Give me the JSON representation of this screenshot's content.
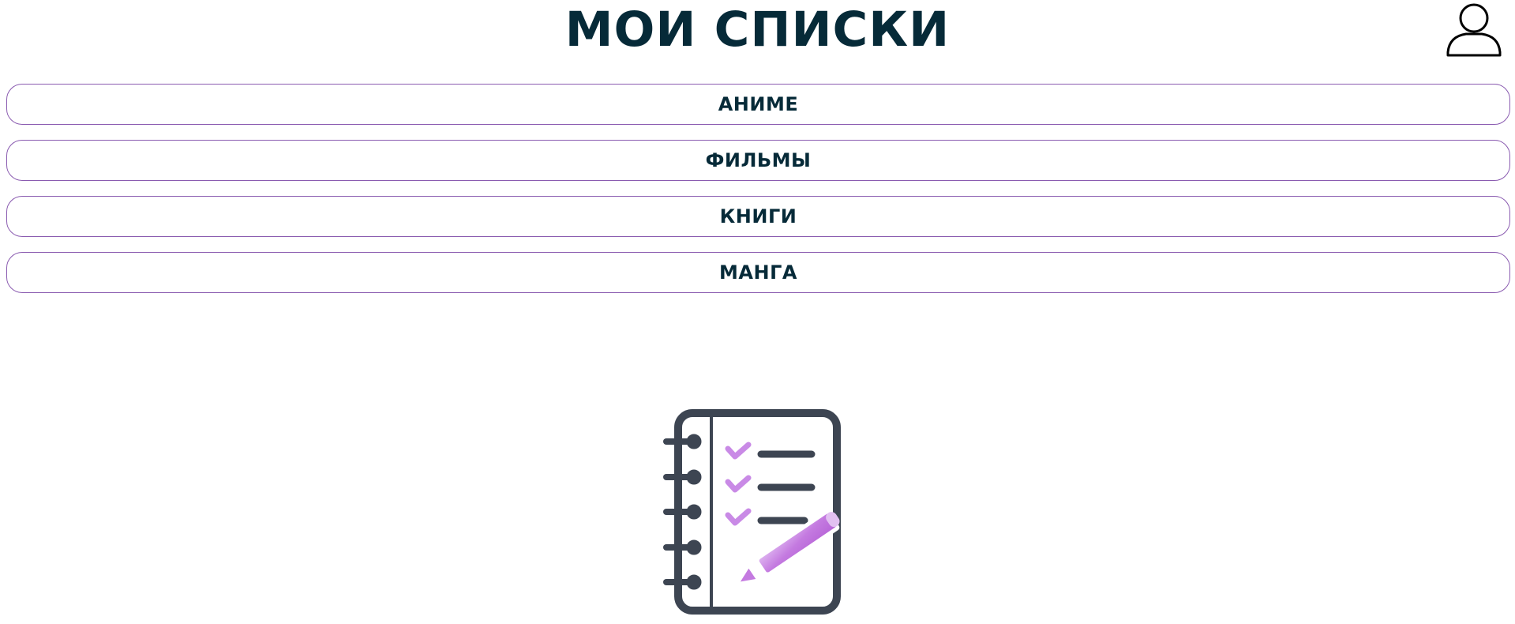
{
  "header": {
    "title": "МОИ СПИСКИ",
    "profile_icon": "user-icon"
  },
  "lists": [
    {
      "label": "АНИМЕ"
    },
    {
      "label": "ФИЛЬМЫ"
    },
    {
      "label": "КНИГИ"
    },
    {
      "label": "МАНГА"
    }
  ],
  "illustration": {
    "icon": "notebook-checklist-icon",
    "accent_icon": "pencil-icon"
  },
  "colors": {
    "title": "#062a38",
    "button_border": "#8a5bb0",
    "icon_dark": "#3d4552",
    "icon_accent": "#c47ae0"
  }
}
